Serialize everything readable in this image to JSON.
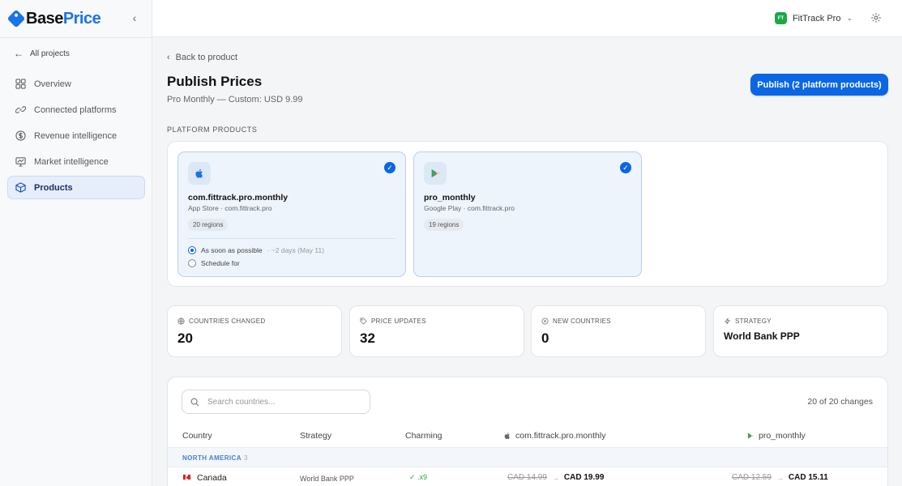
{
  "brand": {
    "name_part1": "Base",
    "name_part2": "Price"
  },
  "sidebar": {
    "back_label": "All projects",
    "items": [
      {
        "label": "Overview",
        "icon": "grid-icon"
      },
      {
        "label": "Connected platforms",
        "icon": "link-icon"
      },
      {
        "label": "Revenue intelligence",
        "icon": "dollar-icon"
      },
      {
        "label": "Market intelligence",
        "icon": "chart-icon"
      },
      {
        "label": "Products",
        "icon": "box-icon",
        "active": true
      }
    ]
  },
  "topbar": {
    "project_initials": "FT",
    "project_name": "FitTrack Pro"
  },
  "page": {
    "back_label": "Back to product",
    "title": "Publish Prices",
    "subtitle": "Pro Monthly — Custom: USD 9.99",
    "publish_label": "Publish (2 platform products)",
    "section_label": "PLATFORM PRODUCTS"
  },
  "products": [
    {
      "name": "com.fittrack.pro.monthly",
      "meta": "App Store · com.fittrack.pro",
      "regions": "20 regions",
      "option_asap": "As soon as possible",
      "option_asap_note": "· ~2 days (May 11)",
      "option_schedule": "Schedule for"
    },
    {
      "name": "pro_monthly",
      "meta": "Google Play · com.fittrack.pro",
      "regions": "19 regions"
    }
  ],
  "stats": [
    {
      "label": "COUNTRIES CHANGED",
      "value": "20",
      "icon": "globe-icon"
    },
    {
      "label": "PRICE UPDATES",
      "value": "32",
      "icon": "tag-icon"
    },
    {
      "label": "NEW COUNTRIES",
      "value": "0",
      "icon": "plus-circle-icon"
    },
    {
      "label": "STRATEGY",
      "value": "World Bank PPP",
      "icon": "bolt-icon"
    }
  ],
  "table": {
    "search_placeholder": "Search countries...",
    "change_count": "20 of 20 changes",
    "headers": {
      "country": "Country",
      "strategy": "Strategy",
      "charming": "Charming",
      "appstore": "com.fittrack.pro.monthly",
      "googleplay": "pro_monthly"
    },
    "group": {
      "label": "NORTH AMERICA",
      "count": "3"
    },
    "rows": [
      {
        "country": "Canada",
        "strategy": "World Bank PPP",
        "charming": "✓ .x9",
        "appstore_old": "CAD 14.99",
        "appstore_new": "CAD 19.99",
        "googleplay_old": "CAD 12.59",
        "googleplay_new": "CAD 15.11"
      }
    ]
  },
  "colors": {
    "accent": "#0a66e4",
    "success": "#2e9d4b",
    "project_badge": "#1fa64a"
  }
}
